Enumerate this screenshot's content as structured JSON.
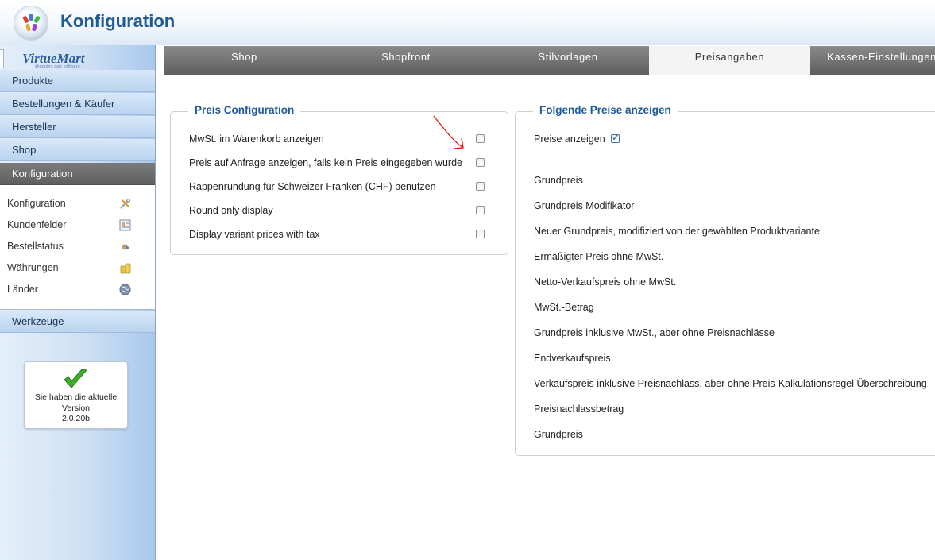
{
  "header": {
    "title": "Konfiguration"
  },
  "sidebar": {
    "logo": {
      "brand": "VirtueMart",
      "tagline": "shopping cart software"
    },
    "nav": [
      {
        "label": "Produkte",
        "active": false
      },
      {
        "label": "Bestellungen & Käufer",
        "active": false
      },
      {
        "label": "Hersteller",
        "active": false
      },
      {
        "label": "Shop",
        "active": false
      },
      {
        "label": "Konfiguration",
        "active": true
      }
    ],
    "submenu": [
      {
        "label": "Konfiguration",
        "icon": "tools-icon"
      },
      {
        "label": "Kundenfelder",
        "icon": "form-icon"
      },
      {
        "label": "Bestellstatus",
        "icon": "status-icon"
      },
      {
        "label": "Währungen",
        "icon": "coins-icon"
      },
      {
        "label": "Länder",
        "icon": "globe-icon"
      }
    ],
    "tools": {
      "label": "Werkzeuge"
    },
    "version": {
      "line1": "Sie haben die aktuelle",
      "line2": "Version",
      "line3": "2.0.20b"
    }
  },
  "tabs": [
    {
      "label": "Shop",
      "active": false
    },
    {
      "label": "Shopfront",
      "active": false
    },
    {
      "label": "Stilvorlagen",
      "active": false
    },
    {
      "label": "Preisangaben",
      "active": true
    },
    {
      "label": "Kassen-Einstellungen",
      "active": false
    }
  ],
  "preis_config": {
    "title": "Preis Configuration",
    "rows": [
      {
        "label": "MwSt. im Warenkorb anzeigen",
        "checked": false
      },
      {
        "label": "Preis auf Anfrage anzeigen, falls kein Preis eingegeben wurde",
        "checked": false
      },
      {
        "label": "Rappenrundung für Schweizer Franken (CHF) benutzen",
        "checked": false
      },
      {
        "label": "Round only display",
        "checked": false
      },
      {
        "label": "Display variant prices with tax",
        "checked": false
      }
    ]
  },
  "folgende_preise": {
    "title": "Folgende Preise anzeigen",
    "show_prices": {
      "label": "Preise anzeigen",
      "checked": true
    },
    "rows": [
      "Grundpreis",
      "Grundpreis Modifikator",
      "Neuer Grundpreis, modifiziert von der gewählten Produktvariante",
      "Ermäßigter Preis ohne MwSt.",
      "Netto-Verkaufspreis ohne MwSt.",
      "MwSt.-Betrag",
      "Grundpreis inklusive MwSt., aber ohne Preisnachlässe",
      "Endverkaufspreis",
      "Verkaufspreis inklusive Preisnachlass, aber ohne Preis-Kalkulationsregel Überschreibung",
      "Preisnachlassbetrag",
      "Grundpreis"
    ]
  },
  "colors": {
    "accent": "#1e5a95",
    "tab_bar": "#6e6e6e",
    "sidebar": "#cfe0f4",
    "annotation": "#e0201a"
  }
}
